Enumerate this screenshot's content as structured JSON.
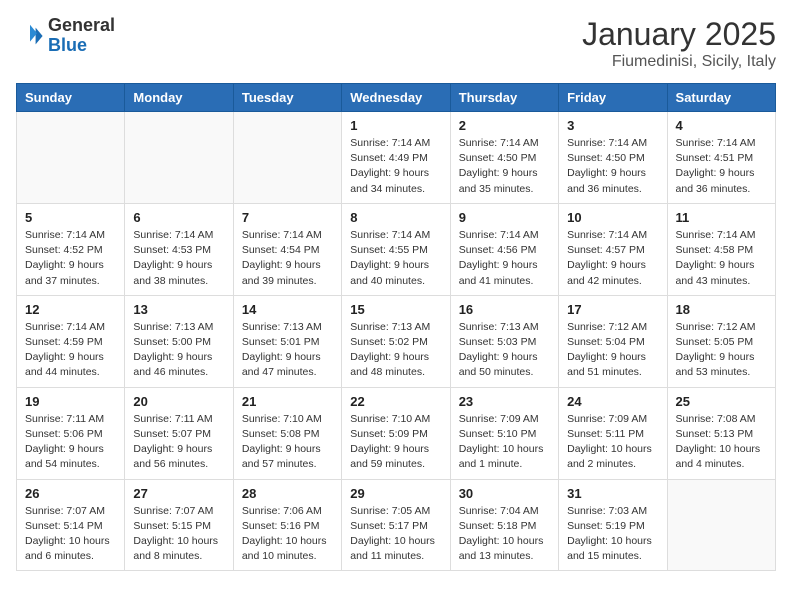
{
  "header": {
    "logo_general": "General",
    "logo_blue": "Blue",
    "month_title": "January 2025",
    "location": "Fiumedinisi, Sicily, Italy"
  },
  "days_of_week": [
    "Sunday",
    "Monday",
    "Tuesday",
    "Wednesday",
    "Thursday",
    "Friday",
    "Saturday"
  ],
  "weeks": [
    [
      {
        "day": "",
        "info": ""
      },
      {
        "day": "",
        "info": ""
      },
      {
        "day": "",
        "info": ""
      },
      {
        "day": "1",
        "info": "Sunrise: 7:14 AM\nSunset: 4:49 PM\nDaylight: 9 hours\nand 34 minutes."
      },
      {
        "day": "2",
        "info": "Sunrise: 7:14 AM\nSunset: 4:50 PM\nDaylight: 9 hours\nand 35 minutes."
      },
      {
        "day": "3",
        "info": "Sunrise: 7:14 AM\nSunset: 4:50 PM\nDaylight: 9 hours\nand 36 minutes."
      },
      {
        "day": "4",
        "info": "Sunrise: 7:14 AM\nSunset: 4:51 PM\nDaylight: 9 hours\nand 36 minutes."
      }
    ],
    [
      {
        "day": "5",
        "info": "Sunrise: 7:14 AM\nSunset: 4:52 PM\nDaylight: 9 hours\nand 37 minutes."
      },
      {
        "day": "6",
        "info": "Sunrise: 7:14 AM\nSunset: 4:53 PM\nDaylight: 9 hours\nand 38 minutes."
      },
      {
        "day": "7",
        "info": "Sunrise: 7:14 AM\nSunset: 4:54 PM\nDaylight: 9 hours\nand 39 minutes."
      },
      {
        "day": "8",
        "info": "Sunrise: 7:14 AM\nSunset: 4:55 PM\nDaylight: 9 hours\nand 40 minutes."
      },
      {
        "day": "9",
        "info": "Sunrise: 7:14 AM\nSunset: 4:56 PM\nDaylight: 9 hours\nand 41 minutes."
      },
      {
        "day": "10",
        "info": "Sunrise: 7:14 AM\nSunset: 4:57 PM\nDaylight: 9 hours\nand 42 minutes."
      },
      {
        "day": "11",
        "info": "Sunrise: 7:14 AM\nSunset: 4:58 PM\nDaylight: 9 hours\nand 43 minutes."
      }
    ],
    [
      {
        "day": "12",
        "info": "Sunrise: 7:14 AM\nSunset: 4:59 PM\nDaylight: 9 hours\nand 44 minutes."
      },
      {
        "day": "13",
        "info": "Sunrise: 7:13 AM\nSunset: 5:00 PM\nDaylight: 9 hours\nand 46 minutes."
      },
      {
        "day": "14",
        "info": "Sunrise: 7:13 AM\nSunset: 5:01 PM\nDaylight: 9 hours\nand 47 minutes."
      },
      {
        "day": "15",
        "info": "Sunrise: 7:13 AM\nSunset: 5:02 PM\nDaylight: 9 hours\nand 48 minutes."
      },
      {
        "day": "16",
        "info": "Sunrise: 7:13 AM\nSunset: 5:03 PM\nDaylight: 9 hours\nand 50 minutes."
      },
      {
        "day": "17",
        "info": "Sunrise: 7:12 AM\nSunset: 5:04 PM\nDaylight: 9 hours\nand 51 minutes."
      },
      {
        "day": "18",
        "info": "Sunrise: 7:12 AM\nSunset: 5:05 PM\nDaylight: 9 hours\nand 53 minutes."
      }
    ],
    [
      {
        "day": "19",
        "info": "Sunrise: 7:11 AM\nSunset: 5:06 PM\nDaylight: 9 hours\nand 54 minutes."
      },
      {
        "day": "20",
        "info": "Sunrise: 7:11 AM\nSunset: 5:07 PM\nDaylight: 9 hours\nand 56 minutes."
      },
      {
        "day": "21",
        "info": "Sunrise: 7:10 AM\nSunset: 5:08 PM\nDaylight: 9 hours\nand 57 minutes."
      },
      {
        "day": "22",
        "info": "Sunrise: 7:10 AM\nSunset: 5:09 PM\nDaylight: 9 hours\nand 59 minutes."
      },
      {
        "day": "23",
        "info": "Sunrise: 7:09 AM\nSunset: 5:10 PM\nDaylight: 10 hours\nand 1 minute."
      },
      {
        "day": "24",
        "info": "Sunrise: 7:09 AM\nSunset: 5:11 PM\nDaylight: 10 hours\nand 2 minutes."
      },
      {
        "day": "25",
        "info": "Sunrise: 7:08 AM\nSunset: 5:13 PM\nDaylight: 10 hours\nand 4 minutes."
      }
    ],
    [
      {
        "day": "26",
        "info": "Sunrise: 7:07 AM\nSunset: 5:14 PM\nDaylight: 10 hours\nand 6 minutes."
      },
      {
        "day": "27",
        "info": "Sunrise: 7:07 AM\nSunset: 5:15 PM\nDaylight: 10 hours\nand 8 minutes."
      },
      {
        "day": "28",
        "info": "Sunrise: 7:06 AM\nSunset: 5:16 PM\nDaylight: 10 hours\nand 10 minutes."
      },
      {
        "day": "29",
        "info": "Sunrise: 7:05 AM\nSunset: 5:17 PM\nDaylight: 10 hours\nand 11 minutes."
      },
      {
        "day": "30",
        "info": "Sunrise: 7:04 AM\nSunset: 5:18 PM\nDaylight: 10 hours\nand 13 minutes."
      },
      {
        "day": "31",
        "info": "Sunrise: 7:03 AM\nSunset: 5:19 PM\nDaylight: 10 hours\nand 15 minutes."
      },
      {
        "day": "",
        "info": ""
      }
    ]
  ]
}
